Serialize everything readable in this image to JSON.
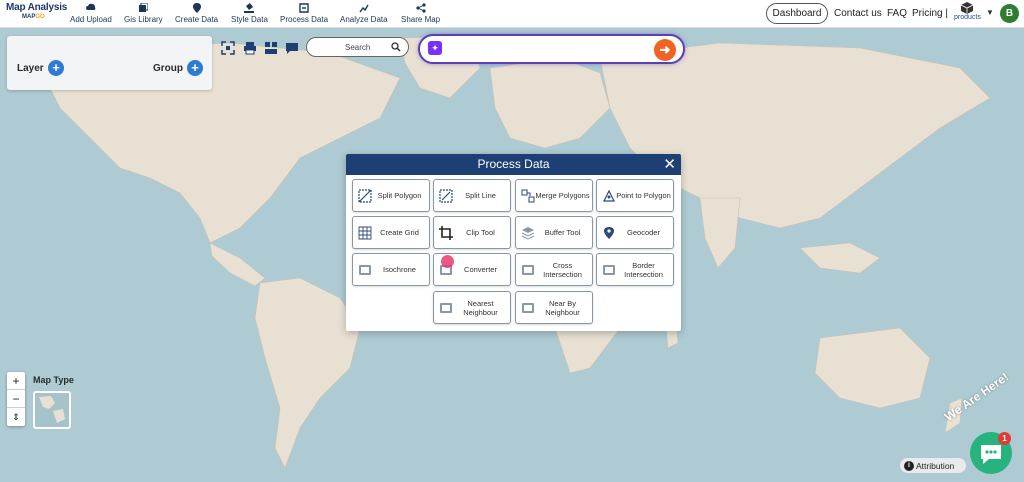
{
  "brand": {
    "title": "Map Analysis",
    "sub_prefix": "MAP",
    "sub_suffix": "GO"
  },
  "nav": {
    "add_upload": "Add Upload",
    "gis_library": "Gis Library",
    "create_data": "Create Data",
    "style_data": "Style Data",
    "process_data": "Process Data",
    "analyze_data": "Analyze Data",
    "share_map": "Share Map",
    "dashboard": "Dashboard",
    "contact": "Contact us",
    "faq": "FAQ",
    "pricing": "Pricing |",
    "products": "products",
    "avatar_initial": "B"
  },
  "layer_panel": {
    "layer_label": "Layer",
    "group_label": "Group"
  },
  "search": {
    "placeholder": "Search"
  },
  "modal": {
    "title": "Process Data",
    "close": "✕",
    "buttons": [
      {
        "label": "Split Polygon",
        "icon": "split-polygon-icon"
      },
      {
        "label": "Split Line",
        "icon": "split-line-icon"
      },
      {
        "label": "Merge Polygons",
        "icon": "merge-polygons-icon"
      },
      {
        "label": "Point to Polygon",
        "icon": "point-to-polygon-icon"
      },
      {
        "label": "Create Grid",
        "icon": "grid-icon"
      },
      {
        "label": "Clip Tool",
        "icon": "crop-icon"
      },
      {
        "label": "Buffer Tool",
        "icon": "layers-icon"
      },
      {
        "label": "Geocoder",
        "icon": "location-pin-icon"
      },
      {
        "label": "Isochrone",
        "icon": "isochrone-icon"
      },
      {
        "label": "Converter",
        "icon": "converter-icon"
      },
      {
        "label": "Cross Intersection",
        "icon": "cross-intersection-icon"
      },
      {
        "label": "Border Intersection",
        "icon": "border-intersection-icon"
      },
      {
        "label": "Nearest Neighbour",
        "icon": "nearest-neighbour-icon"
      },
      {
        "label": "Near By Neighbour",
        "icon": "nearby-neighbour-icon"
      }
    ]
  },
  "zoom": {
    "in": "+",
    "out": "−",
    "reset": "⇕"
  },
  "map_type_label": "Map Type",
  "attribution": "Attribution",
  "chat": {
    "text": "We Are Here!",
    "badge": "1"
  }
}
